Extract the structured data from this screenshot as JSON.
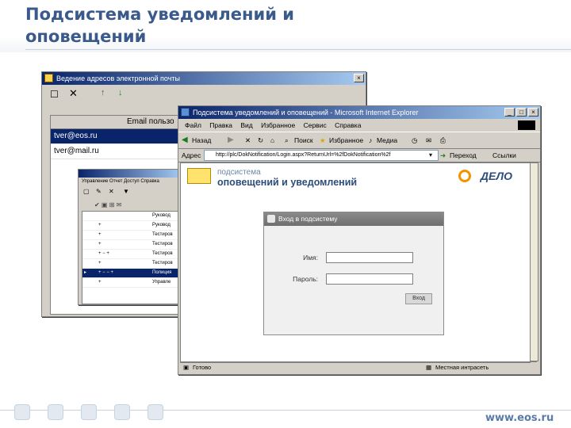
{
  "slide": {
    "title": "Подсистема уведомлений и\nоповещений",
    "footer_site": "www.eos.ru"
  },
  "email_window": {
    "title": "Ведение адресов электронной почты",
    "column_header": "Email пользо",
    "rows": [
      {
        "email": "tver@eos.ru",
        "selected": true
      },
      {
        "email": "tver@mail.ru",
        "selected": false
      }
    ]
  },
  "inner_window": {
    "menu": "Управление Отчет Доступ Справка",
    "rows": [
      {
        "marks": "",
        "label": "Руковод",
        "selected": false
      },
      {
        "marks": "+",
        "label": "Руковод",
        "selected": false
      },
      {
        "marks": "+",
        "label": "Тестиров",
        "selected": false
      },
      {
        "marks": "+",
        "label": "Тестиров",
        "selected": false
      },
      {
        "marks": "+ −   +",
        "label": "Тестиров",
        "selected": false
      },
      {
        "marks": "+",
        "label": "Тестиров",
        "selected": false
      },
      {
        "marks": "+ −  − +",
        "label": "Полиция",
        "selected": true
      },
      {
        "marks": "+",
        "label": "Управле",
        "selected": false
      }
    ]
  },
  "browser": {
    "title": "Подсистема уведомлений и оповещений - Microsoft Internet Explorer",
    "menu": [
      "Файл",
      "Правка",
      "Вид",
      "Избранное",
      "Сервис",
      "Справка"
    ],
    "toolbar": [
      "Назад",
      "Поиск",
      "Избранное",
      "Медиа"
    ],
    "address_label": "Адрес",
    "address_url": "http://plc/DokNotification/Login.aspx?ReturnUrl=%2fDokNotification%2f",
    "goto_label": "Переход",
    "links_label": "Ссылки",
    "status_left": "Готово",
    "status_right": "Местная интрасеть"
  },
  "page": {
    "brand_line1": "подсистема",
    "brand_line2": "оповещений и уведомлений",
    "logo": "ДЕЛО",
    "login": {
      "title": "Вход в подсистему",
      "name_label": "Имя:",
      "password_label": "Пароль:",
      "submit_label": "Вход"
    }
  }
}
